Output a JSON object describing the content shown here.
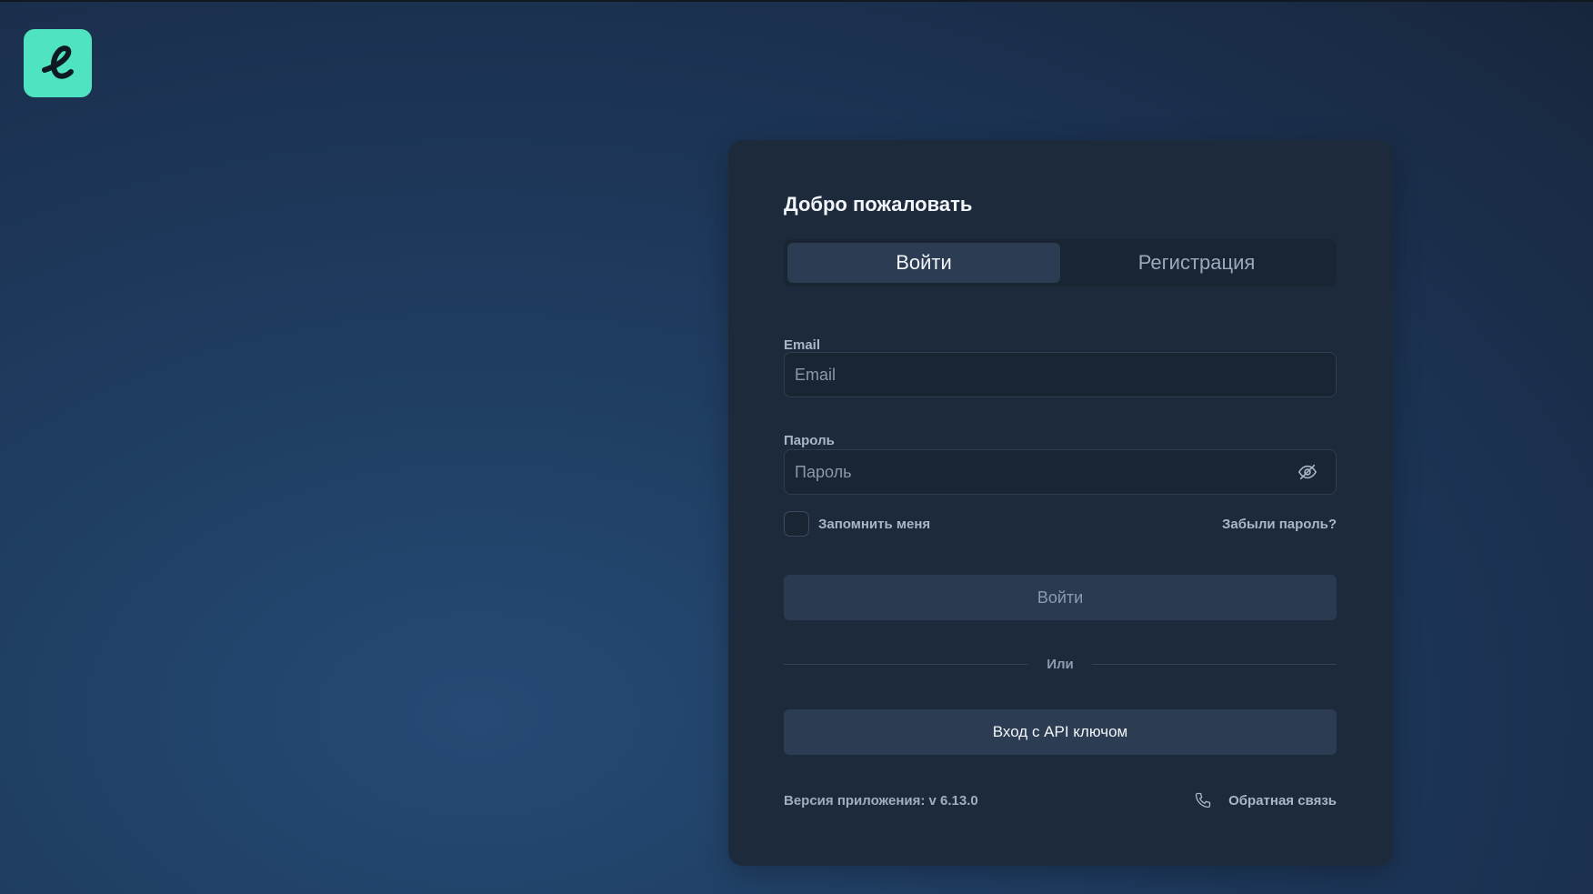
{
  "brand": {
    "logo_icon": "script-e-logo-icon",
    "logo_color": "#4fe3c1"
  },
  "card": {
    "title": "Добро пожаловать",
    "tabs": [
      {
        "label": "Войти",
        "active": true
      },
      {
        "label": "Регистрация",
        "active": false
      }
    ],
    "email": {
      "label": "Email",
      "placeholder": "Email",
      "value": ""
    },
    "password": {
      "label": "Пароль",
      "placeholder": "Пароль",
      "value": "",
      "toggle_icon": "eye-off-icon"
    },
    "remember_label": "Запомнить меня",
    "forgot_label": "Забыли пароль?",
    "login_button": "Войти",
    "or_label": "Или",
    "api_button": "Вход с API ключом",
    "version_text": "Версия приложения: v 6.13.0",
    "feedback": {
      "icon": "phone-icon",
      "label": "Обратная связь"
    }
  }
}
